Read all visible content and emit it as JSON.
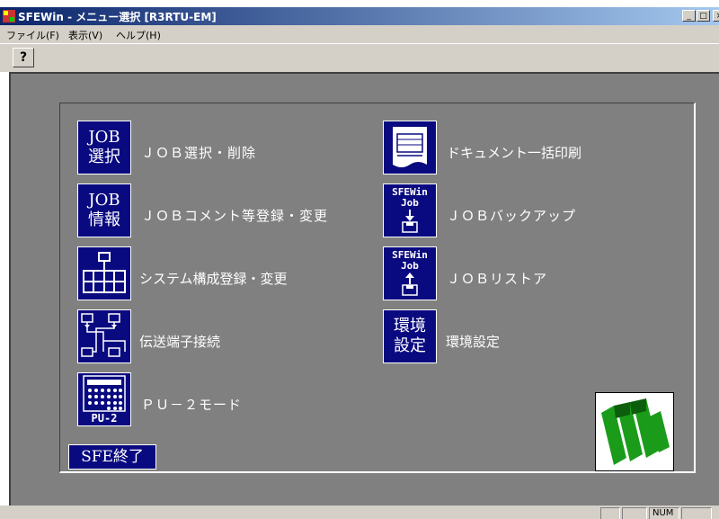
{
  "window": {
    "title": "SFEWin - メニュー選択 [R3RTU-EM]",
    "min_glyph": "_",
    "max_glyph": "□",
    "close_glyph": "×"
  },
  "menu": {
    "items": [
      {
        "label": "ファイル(F)"
      },
      {
        "label": "表示(V)"
      },
      {
        "label": "ヘルプ(H)"
      }
    ]
  },
  "toolbar": {
    "help_glyph": "?"
  },
  "left_items": [
    {
      "icon_line1": "JOB",
      "icon_line2": "選択",
      "label": "ＪＯＢ選択・削除"
    },
    {
      "icon_line1": "JOB",
      "icon_line2": "情報",
      "label": "ＪＯＢコメント等登録・変更"
    },
    {
      "label": "システム構成登録・変更"
    },
    {
      "label": "伝送端子接続"
    },
    {
      "icon_caption": "PU-2",
      "label": "ＰＵ－２モード"
    }
  ],
  "right_items": [
    {
      "label": "ドキュメント一括印刷"
    },
    {
      "icon_line1": "SFEWin",
      "icon_line2": "Job",
      "label": "ＪＯＢバックアップ"
    },
    {
      "icon_line1": "SFEWin",
      "icon_line2": "Job",
      "label": "ＪＯＢリストア"
    },
    {
      "icon_line1": "環境",
      "icon_line2": "設定",
      "label": "環境設定"
    }
  ],
  "exit_button": {
    "label": "SFE終了"
  },
  "statusbar": {
    "num": "NUM"
  },
  "colors": {
    "tile": "#0a0a80",
    "background": "#808080",
    "logo_green": "#1a9c1a"
  }
}
